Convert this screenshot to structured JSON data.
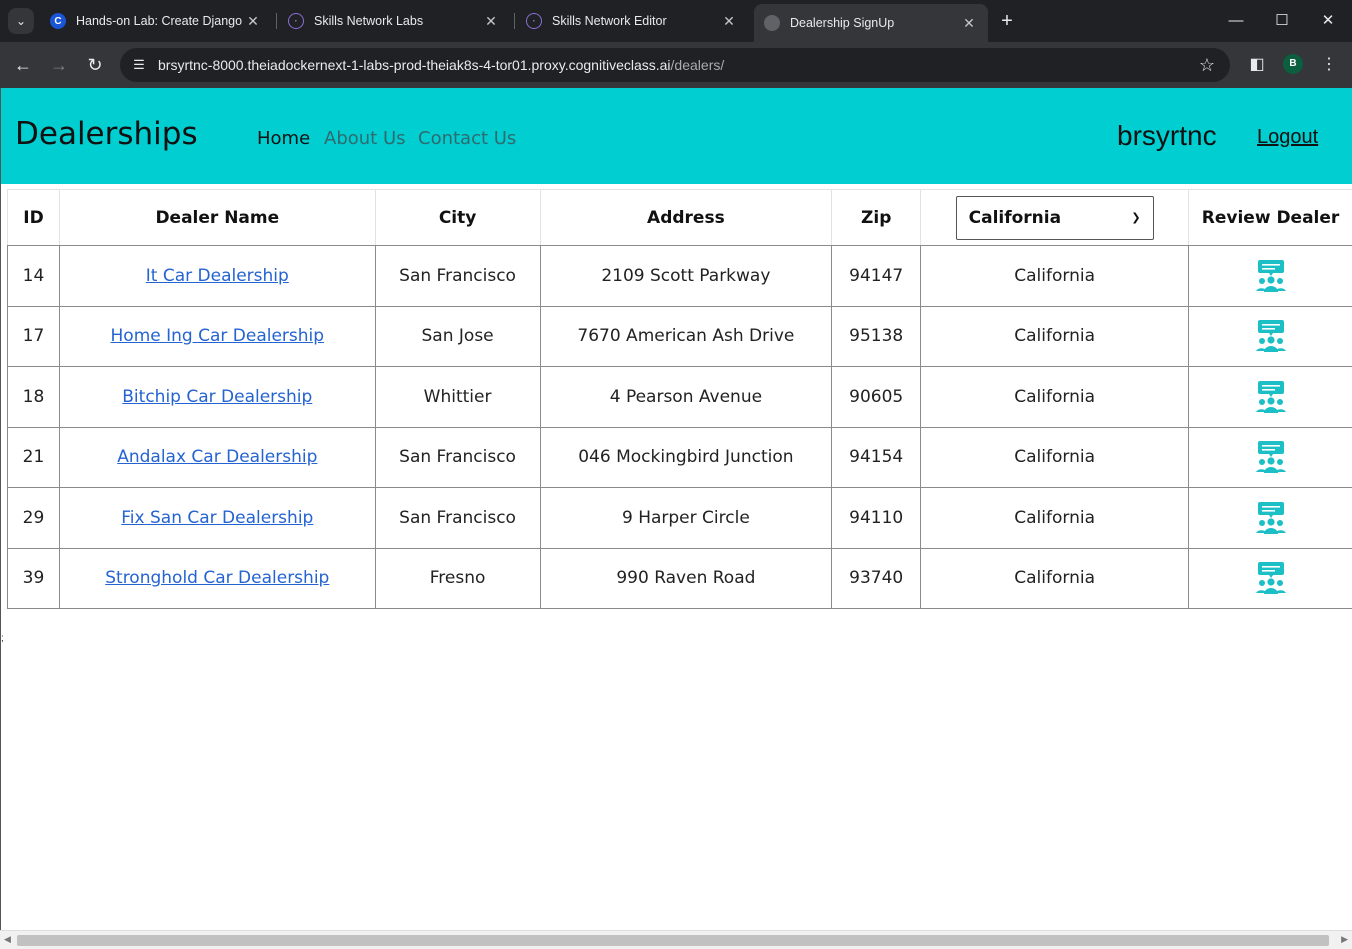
{
  "browser": {
    "tabs": [
      {
        "title": "Hands-on Lab: Create Django P",
        "favicon": "coursera-c-icon"
      },
      {
        "title": "Skills Network Labs",
        "favicon": "skills-network-icon"
      },
      {
        "title": "Skills Network Editor",
        "favicon": "skills-network-icon"
      },
      {
        "title": "Dealership SignUp",
        "favicon": "globe-icon",
        "active": true
      }
    ],
    "url_host": "brsyrtnc-8000.theiadockernext-1-labs-prod-theiak8s-4-tor01.proxy.cognitiveclass.ai",
    "url_path": "/dealers/",
    "profile_initial": "B"
  },
  "navbar": {
    "brand": "Dealerships",
    "links": [
      "Home",
      "About Us",
      "Contact Us"
    ],
    "username": "brsyrtnc",
    "logout": "Logout",
    "background": "#00ced1"
  },
  "table": {
    "headers": {
      "id": "ID",
      "name": "Dealer Name",
      "city": "City",
      "address": "Address",
      "zip": "Zip",
      "review": "Review Dealer"
    },
    "state_filter": "California",
    "rows": [
      {
        "id": "14",
        "name": "It Car Dealership",
        "city": "San Francisco",
        "address": "2109 Scott Parkway",
        "zip": "94147",
        "state": "California"
      },
      {
        "id": "17",
        "name": "Home Ing Car Dealership",
        "city": "San Jose",
        "address": "7670 American Ash Drive",
        "zip": "95138",
        "state": "California"
      },
      {
        "id": "18",
        "name": "Bitchip Car Dealership",
        "city": "Whittier",
        "address": "4 Pearson Avenue",
        "zip": "90605",
        "state": "California"
      },
      {
        "id": "21",
        "name": "Andalax Car Dealership",
        "city": "San Francisco",
        "address": "046 Mockingbird Junction",
        "zip": "94154",
        "state": "California"
      },
      {
        "id": "29",
        "name": "Fix San Car Dealership",
        "city": "San Francisco",
        "address": "9 Harper Circle",
        "zip": "94110",
        "state": "California"
      },
      {
        "id": "39",
        "name": "Stronghold Car Dealership",
        "city": "Fresno",
        "address": "990 Raven Road",
        "zip": "93740",
        "state": "California"
      }
    ],
    "review_icon": "review-people-icon",
    "review_icon_color": "#1cbfc6"
  },
  "stray_text": ";"
}
